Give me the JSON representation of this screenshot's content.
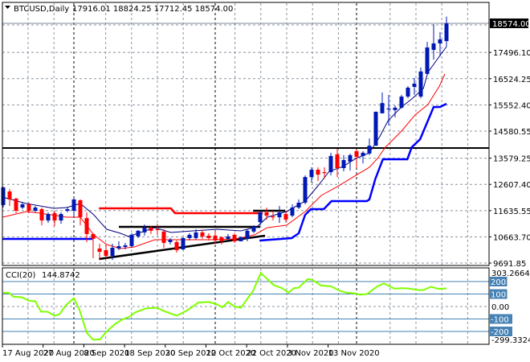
{
  "header": {
    "symbol": "BTCUSD,Daily",
    "ohlc_text": "17916.01 18824.25 17712.45 18574.00"
  },
  "colors": {
    "bull": "#0019b4",
    "bear": "#ff0000",
    "fast_ma": "#000080",
    "slow_ma": "#ff0000",
    "blue_step": "#0000ff",
    "red_step": "#ff0000",
    "cci": "#7fff00",
    "cci_level": "#4682b4",
    "grid": "#8a94a0"
  },
  "chart_data": [
    {
      "type": "candlestick",
      "title": "BTCUSD,Daily",
      "current_price_label": "18574.00",
      "y_tick_labels": [
        "17496.10",
        "16524.25",
        "15552.40",
        "14580.55",
        "13579.25",
        "12607.40",
        "11635.55",
        "10663.70",
        "9691.85"
      ],
      "ylim": [
        9600,
        18950
      ],
      "x_tick_labels": [
        "17 Aug 2020",
        "27 Aug 2020",
        "8 Sep 2020",
        "18 Sep 2020",
        "30 Sep 2020",
        "12 Oct 2020",
        "22 Oct 2020",
        "3 Nov 2020",
        "13 Nov 2020"
      ],
      "ohlc": [
        [
          11840,
          12525,
          11750,
          12495
        ],
        [
          12345,
          12435,
          11810,
          12050
        ],
        [
          12080,
          12110,
          11540,
          11630
        ],
        [
          11750,
          11930,
          11690,
          11870
        ],
        [
          11870,
          11930,
          11540,
          11630
        ],
        [
          11630,
          11810,
          11570,
          11750
        ],
        [
          11690,
          11750,
          11090,
          11270
        ],
        [
          11270,
          11570,
          11180,
          11510
        ],
        [
          11540,
          11630,
          11060,
          11270
        ],
        [
          11270,
          11570,
          11150,
          11510
        ],
        [
          11630,
          11780,
          11570,
          11690
        ],
        [
          11630,
          12110,
          11390,
          12050
        ],
        [
          12020,
          12050,
          11090,
          11390
        ],
        [
          11360,
          11570,
          10470,
          10770
        ],
        [
          10770,
          10800,
          9870,
          10590
        ],
        [
          10230,
          10410,
          9810,
          10110
        ],
        [
          10170,
          10350,
          9870,
          9960
        ],
        [
          9960,
          10410,
          9810,
          10260
        ],
        [
          10230,
          10500,
          10170,
          10320
        ],
        [
          10290,
          10440,
          10200,
          10350
        ],
        [
          10320,
          10800,
          10260,
          10740
        ],
        [
          10680,
          10920,
          10620,
          10890
        ],
        [
          10830,
          11120,
          10710,
          11000
        ],
        [
          11000,
          11060,
          10770,
          10890
        ],
        [
          10950,
          11150,
          10740,
          10920
        ],
        [
          10860,
          10950,
          10260,
          10440
        ],
        [
          10470,
          10620,
          10380,
          10560
        ],
        [
          10470,
          10530,
          10080,
          10170
        ],
        [
          10200,
          10650,
          10170,
          10620
        ],
        [
          10620,
          10800,
          10530,
          10740
        ],
        [
          10620,
          10950,
          10560,
          10830
        ],
        [
          10830,
          10920,
          10590,
          10680
        ],
        [
          10710,
          10800,
          10530,
          10620
        ],
        [
          10710,
          10890,
          10410,
          10530
        ],
        [
          10650,
          10680,
          10380,
          10500
        ],
        [
          10590,
          10770,
          10530,
          10680
        ],
        [
          10740,
          10800,
          10440,
          10500
        ],
        [
          10500,
          10680,
          10500,
          10650
        ],
        [
          10590,
          10950,
          10500,
          10890
        ],
        [
          10860,
          11090,
          10800,
          11040
        ],
        [
          11210,
          11630,
          11090,
          11570
        ],
        [
          11570,
          11750,
          11300,
          11450
        ],
        [
          11420,
          11630,
          11270,
          11390
        ],
        [
          11390,
          11810,
          11180,
          11570
        ],
        [
          11510,
          11630,
          11210,
          11300
        ],
        [
          11450,
          11870,
          11390,
          11750
        ],
        [
          11750,
          12050,
          11690,
          11930
        ],
        [
          11930,
          12940,
          11870,
          12880
        ],
        [
          12880,
          13240,
          12670,
          13150
        ],
        [
          13150,
          13240,
          12730,
          12970
        ],
        [
          13060,
          13240,
          12820,
          13030
        ],
        [
          13060,
          13780,
          12940,
          13660
        ],
        [
          13720,
          13920,
          12880,
          13210
        ],
        [
          13210,
          13690,
          13090,
          13510
        ],
        [
          13450,
          13750,
          13120,
          13690
        ],
        [
          13840,
          13900,
          13210,
          13630
        ],
        [
          13660,
          13840,
          13390,
          13780
        ],
        [
          13750,
          14310,
          13690,
          14040
        ],
        [
          14040,
          15300,
          14040,
          15300
        ],
        [
          15240,
          16010,
          15240,
          15620
        ],
        [
          15390,
          15920,
          14790,
          15420
        ],
        [
          15360,
          15530,
          15090,
          15450
        ],
        [
          15450,
          15920,
          15420,
          15860
        ],
        [
          15860,
          16250,
          15800,
          16190
        ],
        [
          16220,
          16550,
          15920,
          16340
        ],
        [
          15860,
          16940,
          15800,
          16790
        ],
        [
          16700,
          17890,
          16700,
          17680
        ],
        [
          17590,
          18540,
          17230,
          17830
        ],
        [
          17830,
          18250,
          17350,
          17980
        ],
        [
          17916.01,
          18824.25,
          17712.45,
          18574.0
        ]
      ],
      "overlays": {
        "fast_ma": [
          [
            -0.1,
            12137
          ],
          [
            3.6,
            11899
          ],
          [
            7.9,
            11720
          ],
          [
            9.9,
            11750
          ],
          [
            12,
            11899
          ],
          [
            14.1,
            11481
          ],
          [
            16.1,
            10945
          ],
          [
            18.25,
            10796
          ],
          [
            19.5,
            10677
          ],
          [
            23.6,
            11005
          ],
          [
            26.1,
            10826
          ],
          [
            29.5,
            10885
          ],
          [
            33.25,
            10945
          ],
          [
            37,
            10885
          ],
          [
            39.5,
            11034
          ],
          [
            41.1,
            11392
          ],
          [
            44.1,
            11601
          ],
          [
            47,
            11988
          ],
          [
            49.1,
            12584
          ],
          [
            50.75,
            13091
          ],
          [
            52.9,
            13270
          ],
          [
            54.9,
            13568
          ],
          [
            57,
            13776
          ],
          [
            58.6,
            14372
          ],
          [
            59.9,
            14968
          ],
          [
            62,
            15475
          ],
          [
            63.6,
            15773
          ],
          [
            65.4,
            16160
          ],
          [
            66.1,
            16756
          ],
          [
            67.9,
            17352
          ],
          [
            69,
            17710
          ]
        ],
        "slow_ma": [
          [
            -0.1,
            11392
          ],
          [
            3.6,
            11601
          ],
          [
            5.75,
            11541
          ],
          [
            9.9,
            11392
          ],
          [
            12,
            11392
          ],
          [
            14.1,
            10736
          ],
          [
            16.1,
            10379
          ],
          [
            18.25,
            10230
          ],
          [
            20.4,
            10289
          ],
          [
            23.6,
            10558
          ],
          [
            32,
            10558
          ],
          [
            36.1,
            10587
          ],
          [
            39.1,
            10736
          ],
          [
            41.1,
            11005
          ],
          [
            44.1,
            11094
          ],
          [
            47,
            11601
          ],
          [
            49.5,
            12197
          ],
          [
            52,
            12524
          ],
          [
            54.9,
            12942
          ],
          [
            57,
            13240
          ],
          [
            58.25,
            13568
          ],
          [
            59.5,
            13985
          ],
          [
            62,
            14581
          ],
          [
            64.1,
            15177
          ],
          [
            66.1,
            15564
          ],
          [
            67.9,
            16249
          ],
          [
            68.75,
            16696
          ]
        ],
        "blue_step": [
          [
            [
              -0.1,
              10587
            ],
            [
              13.9,
              10587
            ]
          ],
          [
            [
              39.9,
              10528
            ],
            [
              44.9,
              10617
            ],
            [
              46,
              10796
            ],
            [
              47,
              11481
            ],
            [
              47.9,
              11690
            ],
            [
              49.9,
              11690
            ],
            [
              51.1,
              11988
            ],
            [
              56.6,
              11988
            ],
            [
              57,
              12048
            ],
            [
              57.9,
              12793
            ],
            [
              59.1,
              13538
            ],
            [
              62.9,
              13538
            ],
            [
              63.6,
              13985
            ],
            [
              64.9,
              14283
            ],
            [
              67,
              15475
            ],
            [
              68,
              15475
            ],
            [
              69,
              15594
            ]
          ]
        ],
        "red_step": [
          [
            [
              14.9,
              11720
            ],
            [
              26.1,
              11720
            ],
            [
              26.75,
              11541
            ],
            [
              40.4,
              11541
            ]
          ]
        ],
        "black_lines": [
          [
            [
              18,
              11034
            ],
            [
              40,
              11034
            ]
          ],
          [
            [
              14.9,
              9843
            ],
            [
              40.75,
              10707
            ]
          ],
          [
            [
              38.9,
              11631
            ],
            [
              43.9,
              11631
            ]
          ]
        ],
        "horizontal_level": 13955
      }
    },
    {
      "type": "line",
      "title": "CCI(20)",
      "value_label": "144.8742",
      "ylim": [
        -299.3324,
        303.2664
      ],
      "ylim_labels": [
        "303.2664",
        "-299.3324"
      ],
      "levels": [
        {
          "value": 200,
          "label": "200"
        },
        {
          "value": 100,
          "label": "100"
        },
        {
          "value": 0,
          "label": "0.00"
        },
        {
          "value": -100,
          "label": "-100"
        },
        {
          "value": -200,
          "label": "-200"
        }
      ],
      "points": [
        [
          0,
          111
        ],
        [
          0.9,
          109
        ],
        [
          1.6,
          78
        ],
        [
          2.9,
          74
        ],
        [
          4,
          46
        ],
        [
          5,
          42
        ],
        [
          5.9,
          -42
        ],
        [
          6.9,
          -42
        ],
        [
          8,
          -74
        ],
        [
          8.75,
          -63
        ],
        [
          9.75,
          10
        ],
        [
          11,
          67
        ],
        [
          11.9,
          -31
        ],
        [
          13,
          -210
        ],
        [
          14,
          -267
        ],
        [
          15.1,
          -263
        ],
        [
          16.1,
          -200
        ],
        [
          17.5,
          -137
        ],
        [
          18.5,
          -105
        ],
        [
          19.6,
          -84
        ],
        [
          20.6,
          -46
        ],
        [
          22.25,
          -15
        ],
        [
          23.9,
          -10
        ],
        [
          25.1,
          -38
        ],
        [
          27,
          -74
        ],
        [
          28.6,
          -32
        ],
        [
          30.4,
          32
        ],
        [
          32,
          36
        ],
        [
          33.1,
          21
        ],
        [
          34.1,
          -6
        ],
        [
          35,
          36
        ],
        [
          36,
          0
        ],
        [
          37,
          -10
        ],
        [
          38.9,
          126
        ],
        [
          40.1,
          269
        ],
        [
          42.1,
          172
        ],
        [
          43.4,
          147
        ],
        [
          44.4,
          111
        ],
        [
          45.25,
          147
        ],
        [
          46,
          151
        ],
        [
          47.4,
          220
        ],
        [
          48.1,
          214
        ],
        [
          49.5,
          168
        ],
        [
          51,
          162
        ],
        [
          52.4,
          126
        ],
        [
          53.4,
          111
        ],
        [
          54.75,
          105
        ],
        [
          55.5,
          95
        ],
        [
          56.6,
          99
        ],
        [
          58.25,
          162
        ],
        [
          59.25,
          185
        ],
        [
          60.9,
          143
        ],
        [
          61.9,
          147
        ],
        [
          63,
          145
        ],
        [
          64.5,
          132
        ],
        [
          65.4,
          132
        ],
        [
          66.6,
          158
        ],
        [
          67.75,
          141
        ],
        [
          69,
          145
        ]
      ]
    }
  ]
}
